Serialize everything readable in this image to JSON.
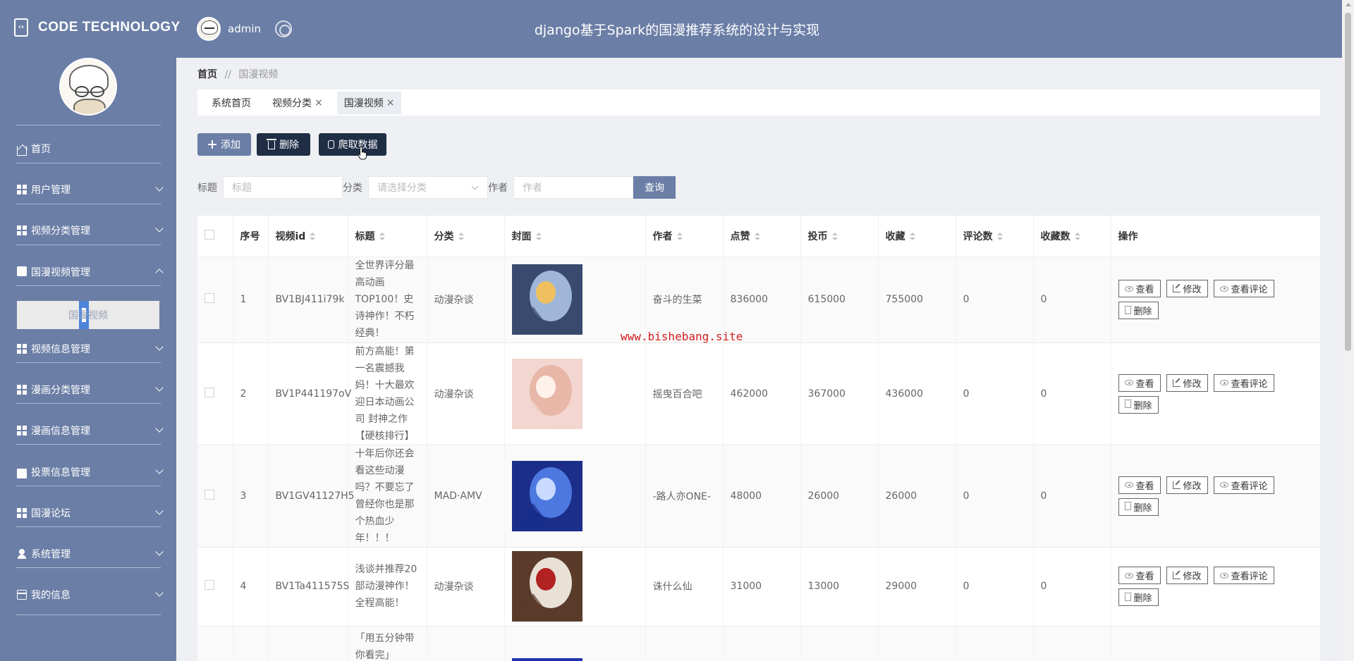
{
  "brand": {
    "name": "CODE TECHNOLOGY",
    "icon": "code-file-icon"
  },
  "header": {
    "username": "admin",
    "system_title": "django基于Spark的国漫推荐系统的设计与实现"
  },
  "sidebar": {
    "items": [
      {
        "label": "首页",
        "icon": "home-icon"
      },
      {
        "label": "用户管理",
        "icon": "grid-icon"
      },
      {
        "label": "视频分类管理",
        "icon": "grid-icon"
      },
      {
        "label": "国漫视频管理",
        "icon": "message-icon"
      },
      {
        "label": "视频信息管理",
        "icon": "grid-icon"
      },
      {
        "label": "漫画分类管理",
        "icon": "grid-icon"
      },
      {
        "label": "漫画信息管理",
        "icon": "grid-icon"
      },
      {
        "label": "投票信息管理",
        "icon": "vote-icon"
      },
      {
        "label": "国漫论坛",
        "icon": "grid-icon"
      },
      {
        "label": "系统管理",
        "icon": "user-icon"
      },
      {
        "label": "我的信息",
        "icon": "card-icon"
      }
    ],
    "submenu_active": "国漫视频"
  },
  "breadcrumb": {
    "home": "首页",
    "separator": "//",
    "current": "国漫视频"
  },
  "tabs": [
    {
      "label": "系统首页"
    },
    {
      "label": "视频分类"
    },
    {
      "label": "国漫视频"
    }
  ],
  "toolbar": {
    "add": "添加",
    "delete": "删除",
    "crawl": "爬取数据"
  },
  "search": {
    "title_label": "标题",
    "title_placeholder": "标题",
    "category_label": "分类",
    "category_placeholder": "请选择分类",
    "author_label": "作者",
    "author_placeholder": "作者",
    "query": "查询"
  },
  "table": {
    "headers": {
      "no": "序号",
      "video_id": "视频id",
      "title": "标题",
      "category": "分类",
      "cover": "封面",
      "author": "作者",
      "likes": "点赞",
      "coins": "投币",
      "favorites": "收藏",
      "comments": "评论数",
      "fav_count": "收藏数",
      "actions": "操作"
    },
    "rows": [
      {
        "no": "1",
        "video_id": "BV1BJ411i79k",
        "title": "全世界评分最高动画TOP100！史诗神作！不朽经典！",
        "category": "动漫杂谈",
        "author": "奋斗的生菜",
        "likes": "836000",
        "coins": "615000",
        "favorites": "755000",
        "comments": "0",
        "fav_count": "0"
      },
      {
        "no": "2",
        "video_id": "BV1P441197oV",
        "title": "前方高能！第一名震撼我妈！十大最欢迎日本动画公司 封神之作【硬核排行】",
        "category": "动漫杂谈",
        "author": "摇曳百合吧",
        "likes": "462000",
        "coins": "367000",
        "favorites": "436000",
        "comments": "0",
        "fav_count": "0"
      },
      {
        "no": "3",
        "video_id": "BV1GV41127H5",
        "title": "十年后你还会看这些动漫吗？不要忘了曾经你也是那个热血少年！！！",
        "category": "MAD·AMV",
        "author": "-路人亦ONE-",
        "likes": "48000",
        "coins": "26000",
        "favorites": "26000",
        "comments": "0",
        "fav_count": "0"
      },
      {
        "no": "4",
        "video_id": "BV1Ta411575S",
        "title": "浅谈并推荐20部动漫神作！全程高能！",
        "category": "动漫杂谈",
        "author": "诛什么仙",
        "likes": "31000",
        "coins": "13000",
        "favorites": "29000",
        "comments": "0",
        "fav_count": "0"
      },
      {
        "no": "",
        "video_id": "",
        "title": "「用五分钟带你看完」",
        "category": "",
        "author": "",
        "likes": "",
        "coins": "",
        "favorites": "",
        "comments": "",
        "fav_count": ""
      }
    ],
    "actions": {
      "view": "查看",
      "edit": "修改",
      "view_comments": "查看评论",
      "delete": "删除"
    }
  },
  "watermark": "www.bishebang.site",
  "colors": {
    "primary": "#6b7ea6",
    "dark_button": "#1f2d45",
    "watermark": "#d21f1f"
  }
}
